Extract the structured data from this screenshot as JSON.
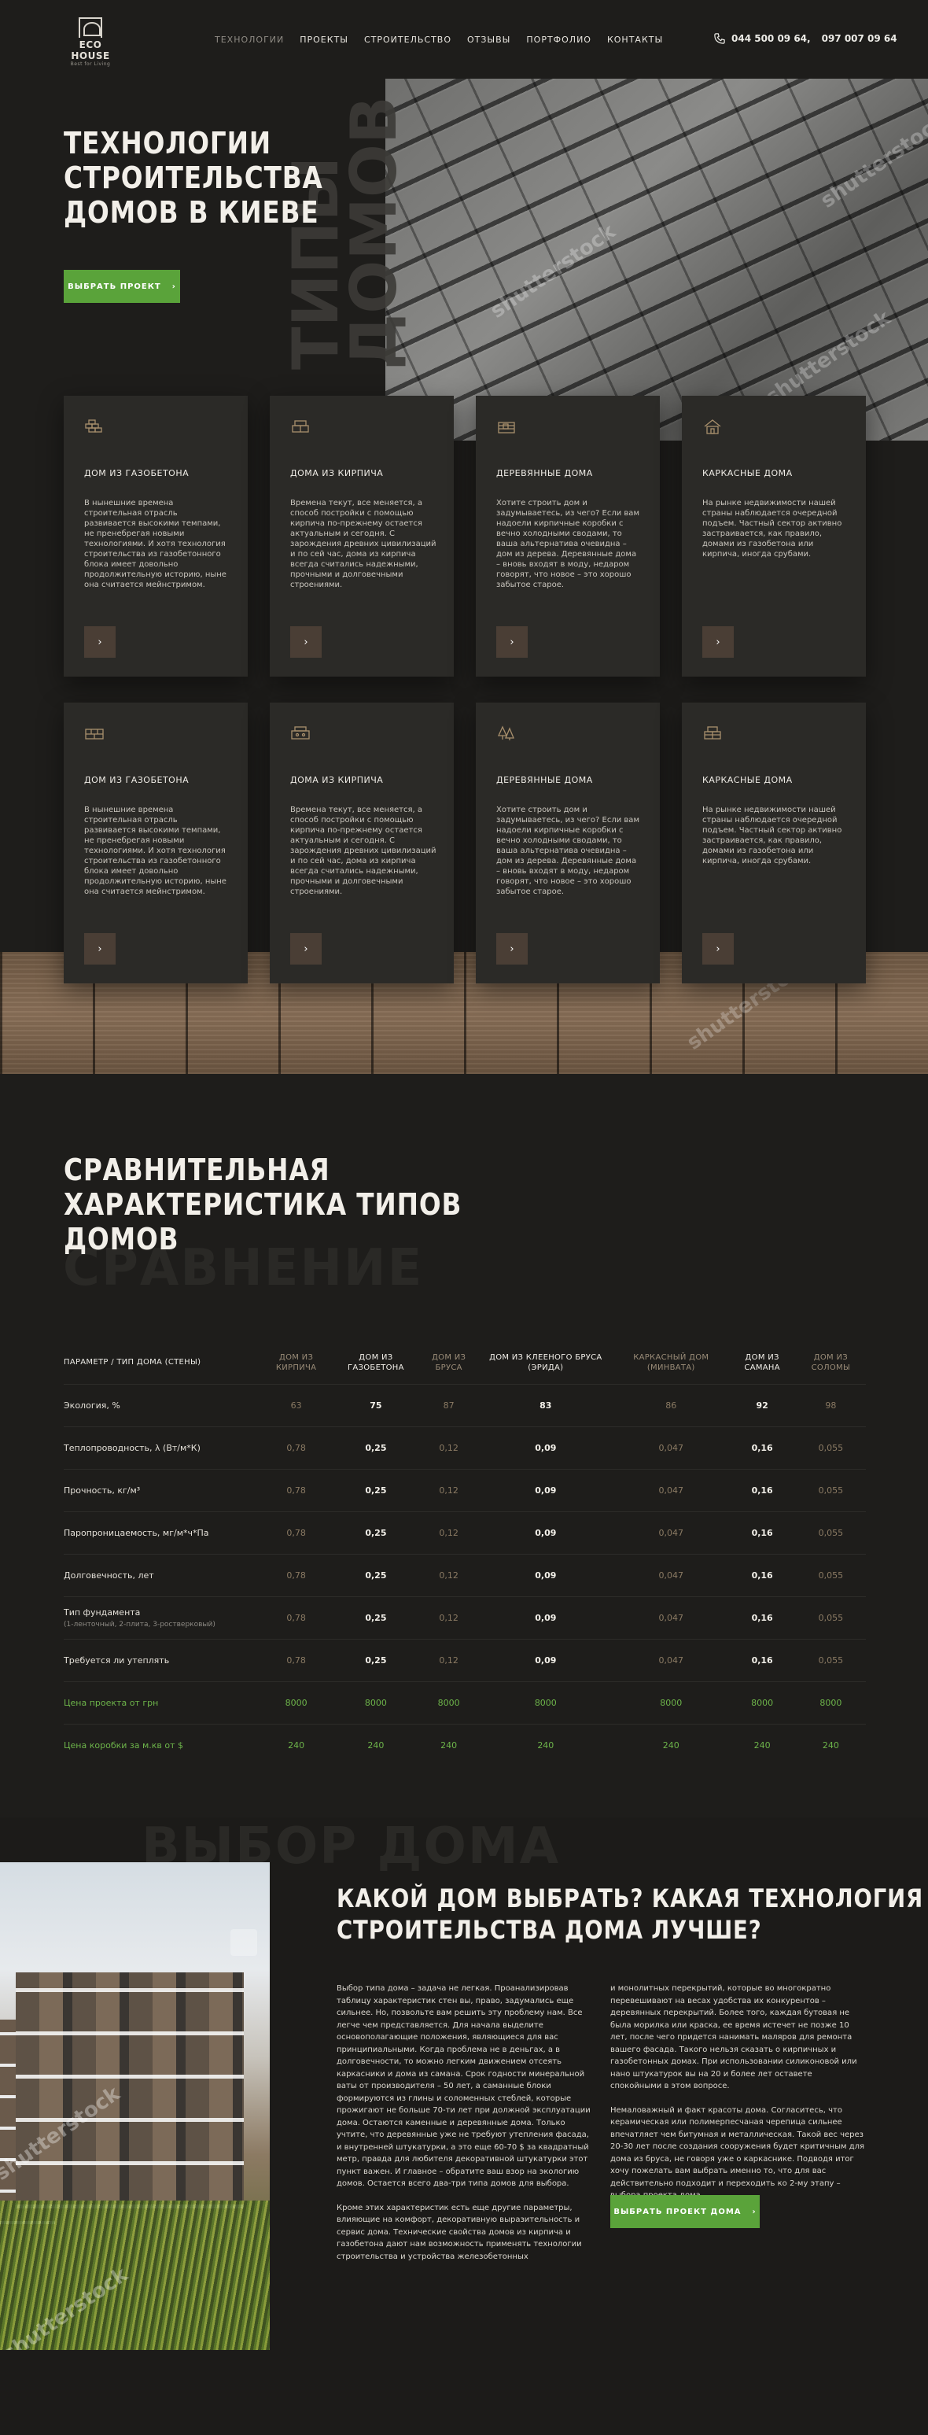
{
  "brand": {
    "name": "ECO HOUSE",
    "tagline": "Best for Living"
  },
  "nav": {
    "items": [
      "ТЕХНОЛОГИИ",
      "ПРОЕКТЫ",
      "СТРОИТЕЛЬСТВО",
      "ОТЗЫВЫ",
      "ПОРТФОЛИО",
      "КОНТАКТЫ"
    ],
    "active": "ТЕХНОЛОГИИ"
  },
  "phones": {
    "phone1": "044 500 09 64,",
    "phone2": "097 007 09 64"
  },
  "hero": {
    "title_lines": [
      "ТЕХНОЛОГИИ",
      "СТРОИТЕЛЬСТВА",
      "ДОМОВ В КИЕВЕ"
    ],
    "bg_word_lines": [
      "ТИПЫ",
      "ДОМОВ"
    ],
    "button": "ВЫБРАТЬ ПРОЕКТ",
    "watermark": "shutterstock"
  },
  "cards_row1": [
    {
      "title": "ДОМ ИЗ ГАЗОБЕТОНА",
      "text": "В нынешние времена строительная отрасль развивается высокими темпами, не пренебрегая новыми технологиями. И хотя технология строительства из газобетонного блока имеет довольно продолжительную историю, ныне она считается мейнстримом.",
      "icon": "brick-wall-icon"
    },
    {
      "title": "ДОМА ИЗ КИРПИЧА",
      "text": "Времена текут, все меняется, а способ постройки с помощью кирпича по-прежнему остается актуальным и сегодня. С зарождения древних цивилизаций и по сей час, дома из кирпича всегда считались надежными, прочными и долговечными строениями.",
      "icon": "brick-stack-icon"
    },
    {
      "title": "ДЕРЕВЯННЫЕ ДОМА",
      "text": "Хотите строить дом и задумываетесь, из чего? Если вам надоели кирпичные коробки с вечно холодными сводами, то ваша альтернатива очевидна – дом из дерева. Деревянные дома – вновь входят в моду, недаром говорят, что новое – это хорошо забытое старое.",
      "icon": "wood-house-icon"
    },
    {
      "title": "КАРКАСНЫЕ ДОМА",
      "text": "На рынке недвижимости нашей страны наблюдается очередной подъем. Частный сектор активно застраивается, как правило, домами из газобетона или кирпича, иногда срубами.",
      "icon": "frame-house-icon"
    }
  ],
  "cards_row2": [
    {
      "title": "ДОМ ИЗ ГАЗОБЕТОНА",
      "text": "В нынешние времена строительная отрасль развивается высокими темпами, не пренебрегая новыми технологиями. И хотя технология строительства из газобетонного блока имеет довольно продолжительную историю, ныне она считается мейнстримом.",
      "icon": "gas-block-icon"
    },
    {
      "title": "ДОМА ИЗ КИРПИЧА",
      "text": "Времена текут, все меняется, а способ постройки с помощью кирпича по-прежнему остается актуальным и сегодня. С зарождения древних цивилизаций и по сей час, дома из кирпича всегда считались надежными, прочными и долговечными строениями.",
      "icon": "brick-block-icon"
    },
    {
      "title": "ДЕРЕВЯННЫЕ ДОМА",
      "text": "Хотите строить дом и задумываетесь, из чего? Если вам надоели кирпичные коробки с вечно холодными сводами, то ваша альтернатива очевидна – дом из дерева. Деревянные дома – вновь входят в моду, недаром говорят, что новое – это хорошо забытое старое.",
      "icon": "forest-icon"
    },
    {
      "title": "КАРКАСНЫЕ ДОМА",
      "text": "На рынке недвижимости нашей страны наблюдается очередной подъем. Частный сектор активно застраивается, как правило, домами из газобетона или кирпича, иногда срубами.",
      "icon": "frame-bricks-icon"
    }
  ],
  "compare": {
    "title_lines": [
      "СРАВНИТЕЛЬНАЯ",
      "ХАРАКТЕРИСТИКА ТИПОВ",
      "ДОМОВ"
    ],
    "bg_word": "СРАВНЕНИЕ",
    "param_header": "ПАРАМЕТР / ТИП ДОМА (СТЕНЫ)",
    "columns": [
      "ДОМ ИЗ КИРПИЧА",
      "ДОМ ИЗ ГАЗОБЕТОНА",
      "ДОМ ИЗ БРУСА",
      "ДОМ ИЗ КЛЕЕНОГО БРУСА (ЭРИДА)",
      "КАРКАСНЫЙ ДОМ (МИНВАТА)",
      "ДОМ ИЗ САМАНА",
      "ДОМ ИЗ СОЛОМЫ"
    ],
    "rows": [
      {
        "param": "Экология, %",
        "sub": "",
        "values": [
          "63",
          "75",
          "87",
          "83",
          "86",
          "92",
          "98"
        ]
      },
      {
        "param": "Теплопроводность, λ (Вт/м*К)",
        "sub": "",
        "values": [
          "0,78",
          "0,25",
          "0,12",
          "0,09",
          "0,047",
          "0,16",
          "0,055"
        ]
      },
      {
        "param": "Прочность, кг/м³",
        "sub": "",
        "values": [
          "0,78",
          "0,25",
          "0,12",
          "0,09",
          "0,047",
          "0,16",
          "0,055"
        ]
      },
      {
        "param": "Паропроницаемость, мг/м*ч*Па",
        "sub": "",
        "values": [
          "0,78",
          "0,25",
          "0,12",
          "0,09",
          "0,047",
          "0,16",
          "0,055"
        ]
      },
      {
        "param": "Долговечность, лет",
        "sub": "",
        "values": [
          "0,78",
          "0,25",
          "0,12",
          "0,09",
          "0,047",
          "0,16",
          "0,055"
        ]
      },
      {
        "param": "Тип фундамента",
        "sub": "(1-ленточный, 2-плита, 3-ростверковый)",
        "values": [
          "0,78",
          "0,25",
          "0,12",
          "0,09",
          "0,047",
          "0,16",
          "0,055"
        ]
      },
      {
        "param": "Требуется ли утеплять",
        "sub": "",
        "values": [
          "0,78",
          "0,25",
          "0,12",
          "0,09",
          "0,047",
          "0,16",
          "0,055"
        ]
      }
    ],
    "price_rows": [
      {
        "param": "Цена проекта от грн",
        "values": [
          "8000",
          "8000",
          "8000",
          "8000",
          "8000",
          "8000",
          "8000"
        ]
      },
      {
        "param": "Цена коробки за м.кв от $",
        "values": [
          "240",
          "240",
          "240",
          "240",
          "240",
          "240",
          "240"
        ]
      }
    ]
  },
  "choose": {
    "bg_word": "ВЫБОР ДОМА",
    "title_lines": [
      "КАКОЙ ДОМ ВЫБРАТЬ? КАКАЯ ТЕХНОЛОГИЯ",
      "СТРОИТЕЛЬСТВА ДОМА ЛУЧШЕ?"
    ],
    "col1_p1": "Выбор типа дома – задача не легкая. Проанализировав таблицу характеристик стен вы, право, задумались еще сильнее. Но, позвольте вам решить эту проблему нам. Все легче чем представляется. Для начала выделите основополагающие положения, являющиеся для вас принципиальными. Когда проблема не в деньгах, а в долговечности, то можно легким движением отсеять каркасники и дома из самана. Срок годности минеральной ваты от производителя – 50 лет, а саманные блоки формируются из глины и соломенных стеблей, которые прожигают не больше 70-ти лет при должной эксплуатации дома. Остаются каменные и деревянные дома. Только учтите, что деревянные уже не требуют утепления фасада, и внутренней штукатурки, а это еще 60-70 $ за квадратный метр, правда для любителя декоративной штукатурки этот пункт важен. И главное – обратите ваш взор на экологию домов. Остается всего два-три типа домов для выбора.",
    "col1_p2": "Кроме этих характеристик есть еще другие параметры, влияющие на комфорт, декоративную выразительность и сервис дома. Технические свойства домов из кирпича и газобетона дают нам возможность применять технологии строительства и устройства железобетонных",
    "col2_p1": "и монолитных перекрытий, которые во многократно перевешивают на весах удобства их конкурентов – деревянных перекрытий. Более того, каждая бутовая не была морилка или краска, ее время истечет не позже 10 лет, после чего придется нанимать маляров для ремонта вашего фасада. Такого нельзя сказать о кирпичных и газобетонных домах. При использовании силиконовой или нано штукатурок вы на 20 и более лет оставете спокойными в этом вопросе.",
    "col2_p2": "Немаловажный и факт красоты дома. Согласитесь, что керамическая или полимерпесчаная черепица сильнее впечатляет чем битумная и металлическая. Такой вес через 20-30 лет после создания сооружения будет критичным для дома из бруса, не говоря уже о каркаснике. Подводя итог хочу пожелать вам выбрать именно то, что для вас действительно подходит и переходить ко 2-му этапу – выбора проекта дома.",
    "button": "ВЫБРАТЬ ПРОЕКТ ДОМА",
    "watermark": "shutterstock"
  },
  "colors": {
    "accent_green": "#5aa33a",
    "card_bg": "#2b2a27",
    "page_bg": "#1c1b19",
    "gold": "#a88f6c"
  }
}
